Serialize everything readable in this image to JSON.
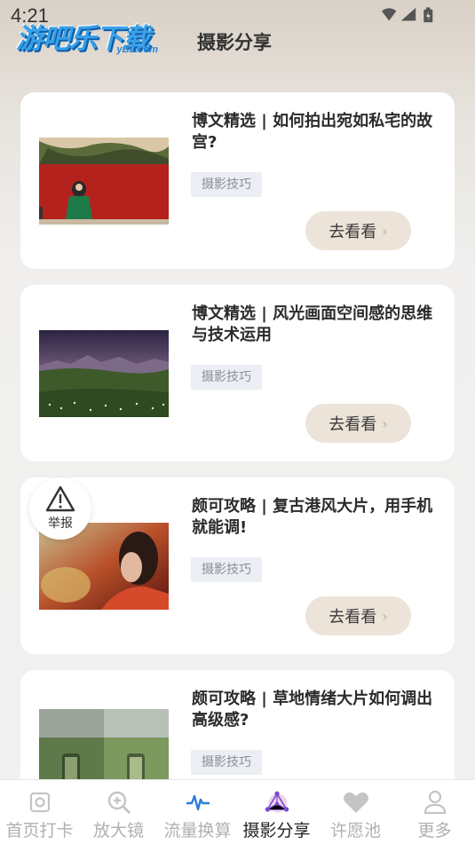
{
  "status_bar": {
    "time": "4:21"
  },
  "logo": {
    "text": "游吧乐下载",
    "sub": "yBL.com"
  },
  "header": {
    "title": "摄影分享"
  },
  "articles": [
    {
      "title": "博文精选 | 如何拍出宛如私宅的故宫?",
      "tag": "摄影技巧",
      "button": "去看看"
    },
    {
      "title": "博文精选 | 风光画面空间感的思维与技术运用",
      "tag": "摄影技巧",
      "button": "去看看"
    },
    {
      "title": "颇可攻略 | 复古港风大片，用手机就能调!",
      "tag": "摄影技巧",
      "button": "去看看"
    },
    {
      "title": "颇可攻略 | 草地情绪大片如何调出高级感?",
      "tag": "摄影技巧",
      "button": "去看看"
    }
  ],
  "report": {
    "label": "举报"
  },
  "bottom_nav": {
    "items": [
      {
        "label": "首页打卡",
        "icon": "camera-square-icon"
      },
      {
        "label": "放大镜",
        "icon": "magnifier-plus-icon"
      },
      {
        "label": "流量换算",
        "icon": "pulse-wave-icon"
      },
      {
        "label": "摄影分享",
        "icon": "triangle-nodes-icon"
      },
      {
        "label": "许愿池",
        "icon": "heart-icon"
      },
      {
        "label": "更多",
        "icon": "person-icon"
      }
    ],
    "active_index": 3,
    "active_color": "#222222",
    "inactive_color": "#b0b0b0"
  },
  "colors": {
    "card_bg": "#ffffff",
    "button_bg": "#ece4d8",
    "tag_bg": "#ebeef3"
  }
}
